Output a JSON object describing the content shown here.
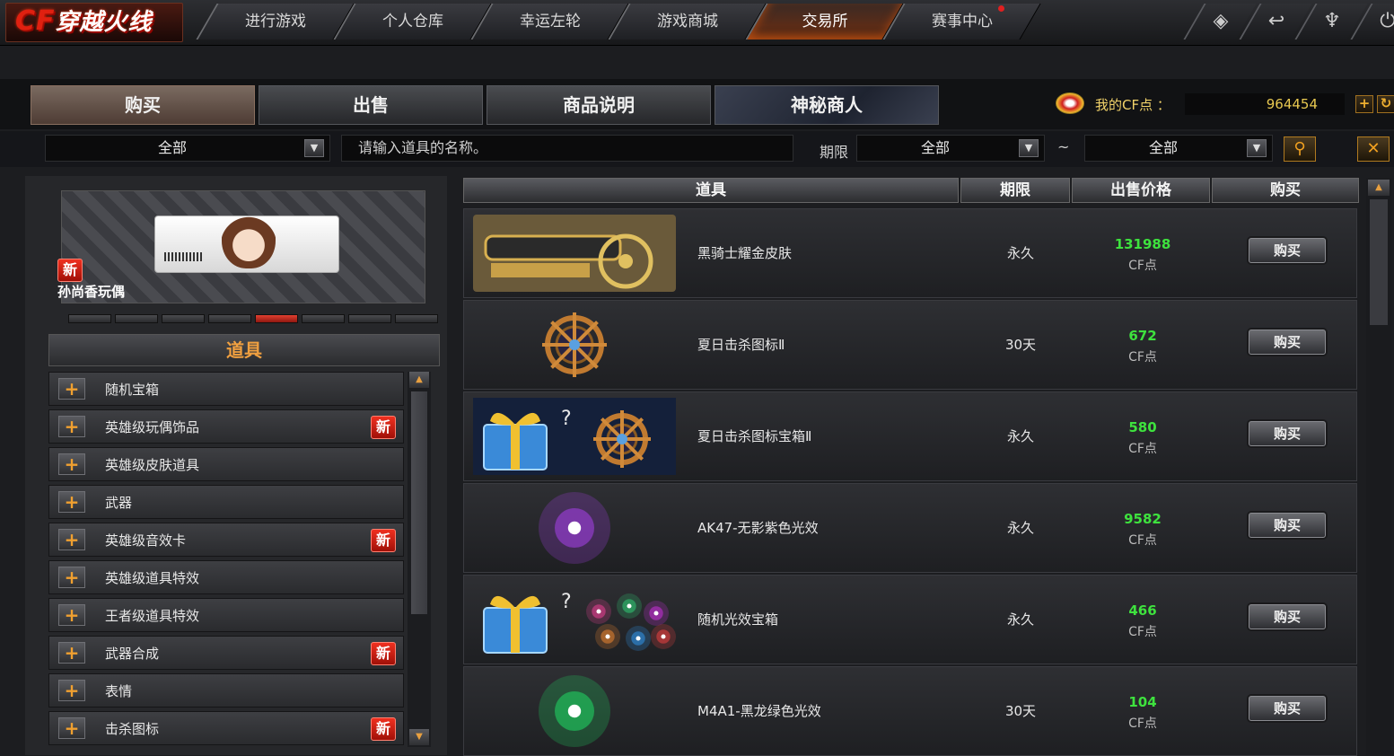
{
  "app": {
    "logo_text": "穿越火线",
    "logo_prefix": "CF"
  },
  "nav": {
    "tabs": [
      {
        "label": "进行游戏"
      },
      {
        "label": "个人仓库"
      },
      {
        "label": "幸运左轮"
      },
      {
        "label": "游戏商城"
      },
      {
        "label": "交易所",
        "active": true
      },
      {
        "label": "赛事中心"
      }
    ],
    "controls": [
      {
        "icon": "shield-icon",
        "glyph": "◈"
      },
      {
        "icon": "return-icon",
        "glyph": "↩"
      },
      {
        "icon": "wrench-icon",
        "glyph": "♆"
      },
      {
        "icon": "power-icon",
        "glyph": "⏻"
      }
    ]
  },
  "subtabs": [
    {
      "label": "购买",
      "active": true
    },
    {
      "label": "出售"
    },
    {
      "label": "商品说明"
    },
    {
      "label": "神秘商人"
    }
  ],
  "cf_points": {
    "label": "我的CF点 ：",
    "value": "964454",
    "add_glyph": "+",
    "refresh_glyph": "↻"
  },
  "filters": {
    "category": "全部",
    "search_placeholder": "请输入道具的名称。",
    "period_label": "期限",
    "period_from": "全部",
    "tilde": "~",
    "period_to": "全部",
    "search_glyph": "⚲",
    "close_glyph": "✕"
  },
  "banner": {
    "badge": "新",
    "title": "孙尚香玩偶"
  },
  "carousel": {
    "count": 8,
    "active_index": 4
  },
  "categories": {
    "header": "道具",
    "items": [
      {
        "label": "随机宝箱",
        "new": false
      },
      {
        "label": "英雄级玩偶饰品",
        "new": true
      },
      {
        "label": "英雄级皮肤道具",
        "new": false
      },
      {
        "label": "武器",
        "new": false
      },
      {
        "label": "英雄级音效卡",
        "new": true
      },
      {
        "label": "英雄级道具特效",
        "new": false
      },
      {
        "label": "王者级道具特效",
        "new": false
      },
      {
        "label": "武器合成",
        "new": true
      },
      {
        "label": "表情",
        "new": false
      },
      {
        "label": "击杀图标",
        "new": true
      }
    ],
    "new_badge": "新",
    "plus_glyph": "+"
  },
  "table": {
    "headers": [
      "道具",
      "期限",
      "出售价格",
      "购买"
    ],
    "buy_label": "购买",
    "unit": "CF点",
    "rows": [
      {
        "name": "黑骑士耀金皮肤",
        "period": "永久",
        "price": "131988",
        "image": "gold-cannon-skin"
      },
      {
        "name": "夏日击杀图标Ⅱ",
        "period": "30天",
        "price": "672",
        "image": "wheel-kill-icon"
      },
      {
        "name": "夏日击杀图标宝箱Ⅱ",
        "period": "永久",
        "price": "580",
        "image": "gift-box-wheel"
      },
      {
        "name": "AK47-无影紫色光效",
        "period": "永久",
        "price": "9582",
        "image": "purple-glow"
      },
      {
        "name": "随机光效宝箱",
        "period": "永久",
        "price": "466",
        "image": "gift-box-glows"
      },
      {
        "name": "M4A1-黑龙绿色光效",
        "period": "30天",
        "price": "104",
        "image": "green-glow"
      }
    ]
  }
}
